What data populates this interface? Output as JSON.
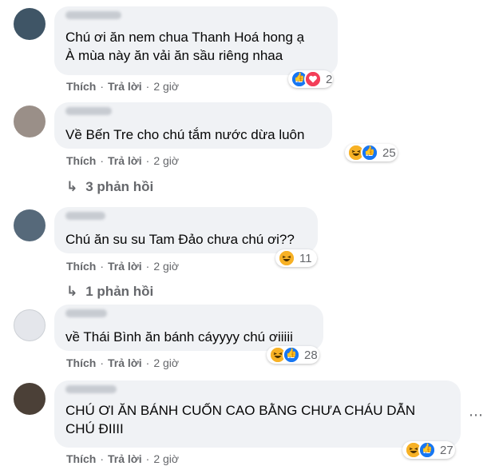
{
  "comments": [
    {
      "text": "Chú ơi ăn nem chua Thanh Hoá hong ạ\nÀ mùa này ăn vải ăn sầu riêng nhaa",
      "reaction_count": "2",
      "reaction_icons": [
        "like-icon",
        "love-icon"
      ],
      "like_label": "Thích",
      "reply_label": "Trả lời",
      "time": "2 giờ"
    },
    {
      "text": "Về Bến Tre cho chú tắm nước dừa luôn",
      "reaction_count": "25",
      "reaction_icons": [
        "haha-icon",
        "like-icon"
      ],
      "like_label": "Thích",
      "reply_label": "Trả lời",
      "time": "2 giờ",
      "replies_label": "3 phản hồi"
    },
    {
      "text": "Chú ăn su su Tam Đảo chưa chú ơi??",
      "reaction_count": "11",
      "reaction_icons": [
        "haha-icon"
      ],
      "like_label": "Thích",
      "reply_label": "Trả lời",
      "time": "2 giờ",
      "replies_label": "1 phản hồi"
    },
    {
      "text": "về Thái Bình ăn bánh cáyyyy chú ơiiiii",
      "reaction_count": "28",
      "reaction_icons": [
        "haha-icon",
        "like-icon"
      ],
      "like_label": "Thích",
      "reply_label": "Trả lời",
      "time": "2 giờ"
    },
    {
      "text": "CHÚ ƠI ĂN BÁNH CUỐN CAO BẰNG CHƯA CHÁU DẪN\nCHÚ ĐIIII",
      "reaction_count": "27",
      "reaction_icons": [
        "haha-icon",
        "like-icon"
      ],
      "like_label": "Thích",
      "reply_label": "Trả lời",
      "time": "2 giờ"
    }
  ],
  "more_options_icon": "more-horizontal-icon",
  "colors": {
    "bubble": "#f0f2f5",
    "meta": "#65676b",
    "like": "#1877f2",
    "love": "#f33e58",
    "haha": "#f7b125"
  }
}
